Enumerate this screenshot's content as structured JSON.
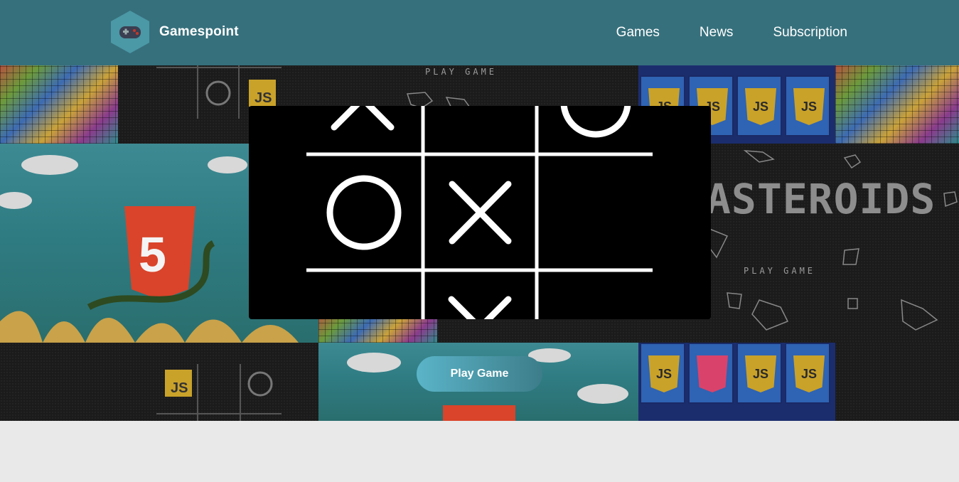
{
  "brand": {
    "name": "Gamespoint",
    "icon": "gamepad-icon"
  },
  "nav": {
    "items": [
      {
        "label": "Games"
      },
      {
        "label": "News"
      },
      {
        "label": "Subscription"
      }
    ]
  },
  "hero": {
    "tile_text": {
      "play_game": "PLAY GAME",
      "asteroids": "ASTEROIDS",
      "js": "JS"
    },
    "game": {
      "board": [
        [
          "X",
          "",
          "O"
        ],
        [
          "O",
          "X",
          ""
        ],
        [
          "",
          "X",
          ""
        ]
      ]
    },
    "play_button": "Play Game"
  },
  "colors": {
    "navbar": "#36707c",
    "button_start": "#5ab4c8",
    "button_end": "#3d7d8a",
    "page_bg": "#e9e9e9"
  }
}
